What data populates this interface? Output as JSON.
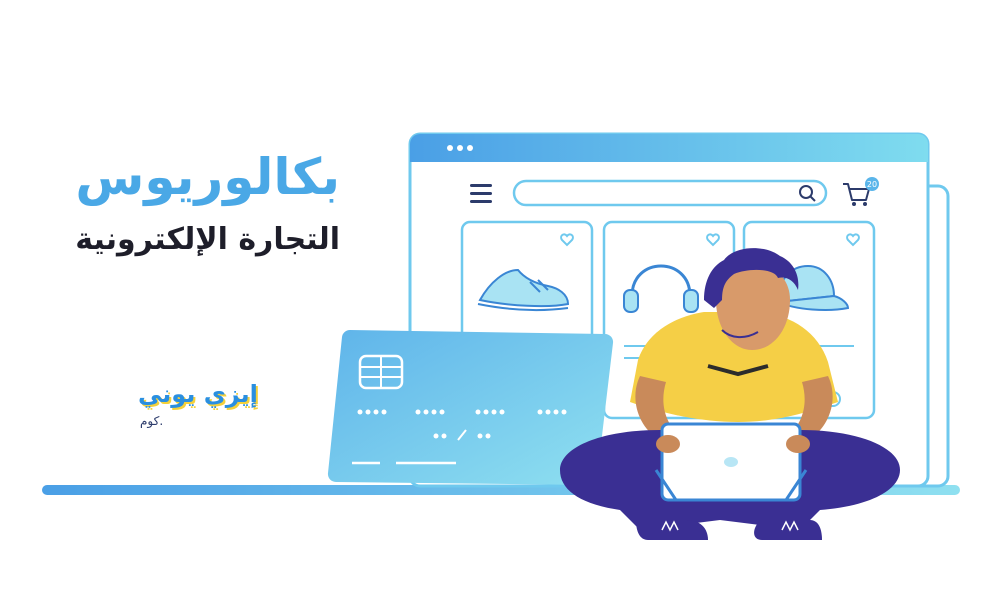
{
  "headline": {
    "title": "بكالوريوس",
    "subtitle": "التجارة الإلكترونية"
  },
  "logo": {
    "name": "إيزي يوني",
    "domain": ".كوم"
  },
  "browser": {
    "cart_count": "20"
  },
  "colors": {
    "title": "#4aa8e6",
    "browser_bar": "#5ab5ea",
    "card": "#6cc3ee",
    "shirt": "#f5cf46",
    "pants": "#3a2f93"
  },
  "icons": [
    "menu-icon",
    "search-icon",
    "cart-icon",
    "heart-icon",
    "shoe-icon",
    "headphones-icon",
    "cap-icon",
    "chip-icon"
  ]
}
